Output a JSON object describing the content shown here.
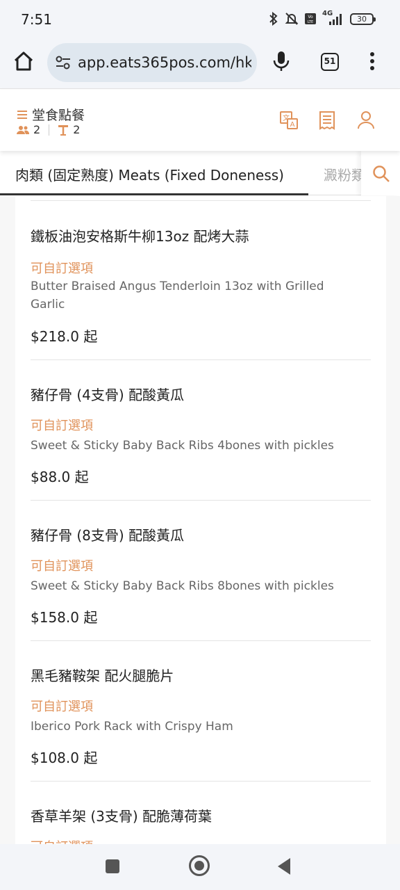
{
  "status_bar": {
    "time": "7:51",
    "battery": "30",
    "network": "4G"
  },
  "browser": {
    "url": "app.eats365pos.com/hk",
    "tab_count": "51"
  },
  "header": {
    "title": "堂食點餐",
    "guest_count": "2",
    "table_count": "2"
  },
  "categories": {
    "active": "肉類 (固定熟度) Meats (Fixed Doneness)",
    "next": "澱粉類"
  },
  "menu_items": [
    {
      "name": "鐵板油泡安格斯牛柳13oz 配烤大蒜",
      "options": "可自訂選項",
      "description": "Butter Braised Angus Tenderloin 13oz with Grilled Garlic",
      "price": "$218.0 起"
    },
    {
      "name": "豬仔骨 (4支骨) 配酸黃瓜",
      "options": "可自訂選項",
      "description": "Sweet & Sticky Baby Back Ribs 4bones with pickles",
      "price": "$88.0 起"
    },
    {
      "name": "豬仔骨 (8支骨) 配酸黃瓜",
      "options": "可自訂選項",
      "description": "Sweet & Sticky Baby Back Ribs 8bones with pickles",
      "price": "$158.0 起"
    },
    {
      "name": "黑毛豬鞍架 配火腿脆片",
      "options": "可自訂選項",
      "description": "Iberico Pork Rack with Crispy Ham",
      "price": "$108.0 起"
    },
    {
      "name": "香草羊架 (3支骨) 配脆薄荷葉",
      "options": "可自訂選項",
      "description": "",
      "price": ""
    }
  ],
  "colors": {
    "accent": "#e0925a",
    "tab_active": "#333333"
  }
}
